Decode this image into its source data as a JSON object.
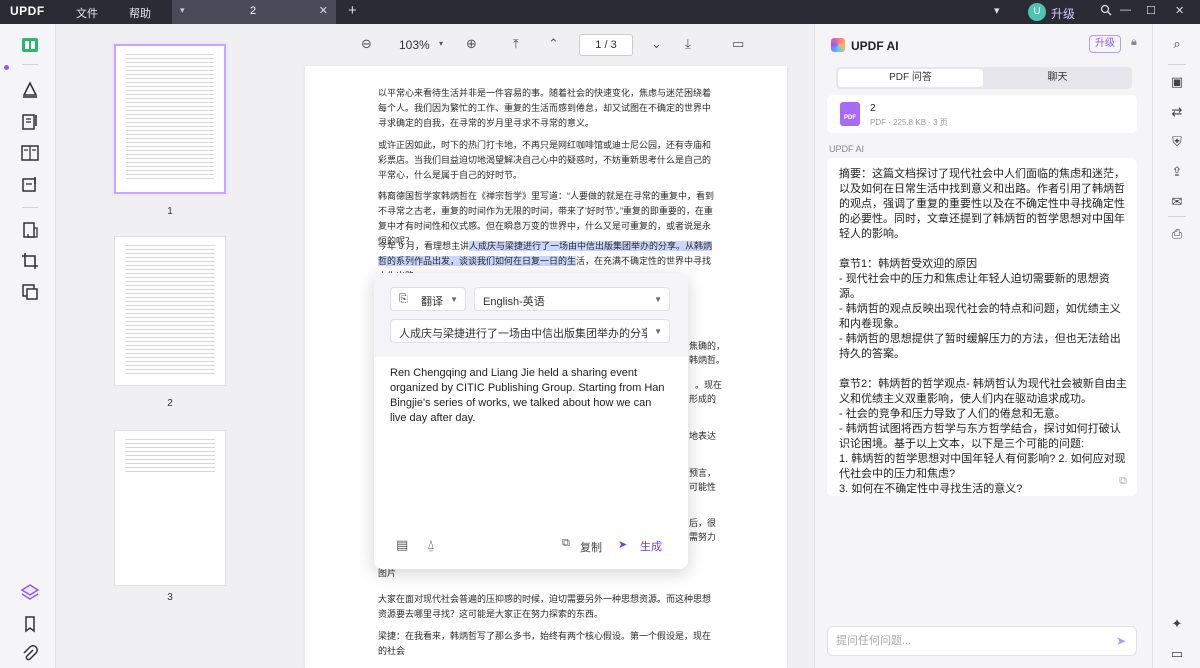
{
  "titlebar": {
    "logo": "UPDF",
    "menu_file": "文件",
    "menu_help": "帮助",
    "tab_label": "2",
    "avatar_letter": "U",
    "upgrade_label": "升级"
  },
  "doc_toolbar": {
    "zoom": "103%",
    "page_indicator": "1  /  3"
  },
  "thumbnails": {
    "page_numbers": [
      "1",
      "2",
      "3"
    ]
  },
  "document": {
    "para1": "以平常心来看待生活并非是一件容易的事。随着社会的快速变化，焦虑与迷茫困绕着每个人。我们因为繁忙的工作、重复的生活而感到倦怠，却又试图在不确定的世界中寻求确定的自我，在寻常的岁月里寻求不寻常的意义。",
    "para2": "或许正因如此，时下的热门打卡地，不再只是网红咖啡馆或迪士尼公园，还有寺庙和彩票店。当我们目益迫切地渴望解决自己心中的疑惑时，不妨重新思考什么是自己的平常心，什么是属于自己的好时节。",
    "para3": "韩裔德国哲学家韩炳哲在《禅宗哲学》里写道：“人要做的就是在寻常的重复中，看到不寻常之古老，重复的时间作为无限的时间，带来了'好时节'。”重复的即重要的，在重复中才有时间性和仪式感。但在瞬息万变的世界中，什么又是可重复的，或者说是永恒的呢？",
    "para4_pre": "今年 9 月，看理想主讲",
    "para4_hl1": "人成庆与梁捷进行了一场由中信出版集团举办的分享。从韩炳哲的系",
    "para4_hl2": "列作品出发，谈谈我们如何在日复一日的生",
    "para4_post": "活，在充满不确定性的世界中寻找人生出路。",
    "frag_a": "焦确的，",
    "frag_b": "韩炳哲。",
    "frag_c": "。现在",
    "frag_d": "形成的",
    "frag_e": "地表达",
    "frag_f": "预言，",
    "frag_g": "可能性",
    "frag_h": "后，很",
    "frag_i": "需努力",
    "caption": "图片",
    "para5": "大家在面对现代社会普遍的压抑感的时候，迫切需要另外一种思想资源。而这种思想资源要去哪里寻找？这可能是大家正在努力探索的东西。",
    "para6": "梁捷：在我看来，韩炳哲写了那么多书，始终有两个核心假设。第一个假设是，现在的社会"
  },
  "translate_popup": {
    "mode": "翻译",
    "language": "English-英语",
    "source": "人成庆与梁捷进行了一场由中信出版集团举办的分享...",
    "result": "Ren Chengqing and Liang Jie held a sharing event organized by CITIC Publishing Group. Starting from Han Bingjie's series of works, we talked about how we can live day after day.",
    "copy_label": "复制",
    "generate_label": "生成"
  },
  "ai_panel": {
    "title": "UPDF AI",
    "upgrade": "升级",
    "tab_qa": "PDF 问答",
    "tab_chat": "聊天",
    "file_name": "2",
    "file_meta": "PDF · 225.8 KB · 3 页",
    "pdf_badge": "PDF",
    "sender_label": "UPDF AI",
    "summary": "摘要：这篇文档探讨了现代社会中人们面临的焦虑和迷茫，以及如何在日常生活中找到意义和出路。作者引用了韩炳哲的观点，强调了重复的重要性以及在不确定性中寻找确定性的必要性。同时，文章还提到了韩炳哲的哲学思想对中国年轻人的影响。",
    "chapter1_title": "章节1：韩炳哲受欢迎的原因",
    "chapter1_b1": "- 现代社会中的压力和焦虑让年轻人迫切需要新的思想资源。",
    "chapter1_b2": "- 韩炳哲的观点反映出现代社会的特点和问题，如优绩主义和内卷现象。",
    "chapter1_b3": "- 韩炳哲的思想提供了暂时缓解压力的方法，但也无法给出持久的答案。",
    "chapter2_title": "章节2：韩炳哲的哲学观点- 韩炳哲认为现代社会被新自由主义和优绩主义双重影响，使人们内在驱动追求成功。",
    "chapter2_b1": "- 社会的竞争和压力导致了人们的倦怠和无意。",
    "chapter2_b2": "- 韩炳哲试图将西方哲学与东方哲学结合，探讨如何打破认识论困境。基于以上文本，以下是三个可能的问题:",
    "q1": "1. 韩炳哲的哲学思想对中国年轻人有何影响? 2. 如何应对现代社会中的压力和焦虑?",
    "q3": "3. 如何在不确定性中寻找生活的意义?",
    "input_placeholder": "提问任何问题..."
  }
}
